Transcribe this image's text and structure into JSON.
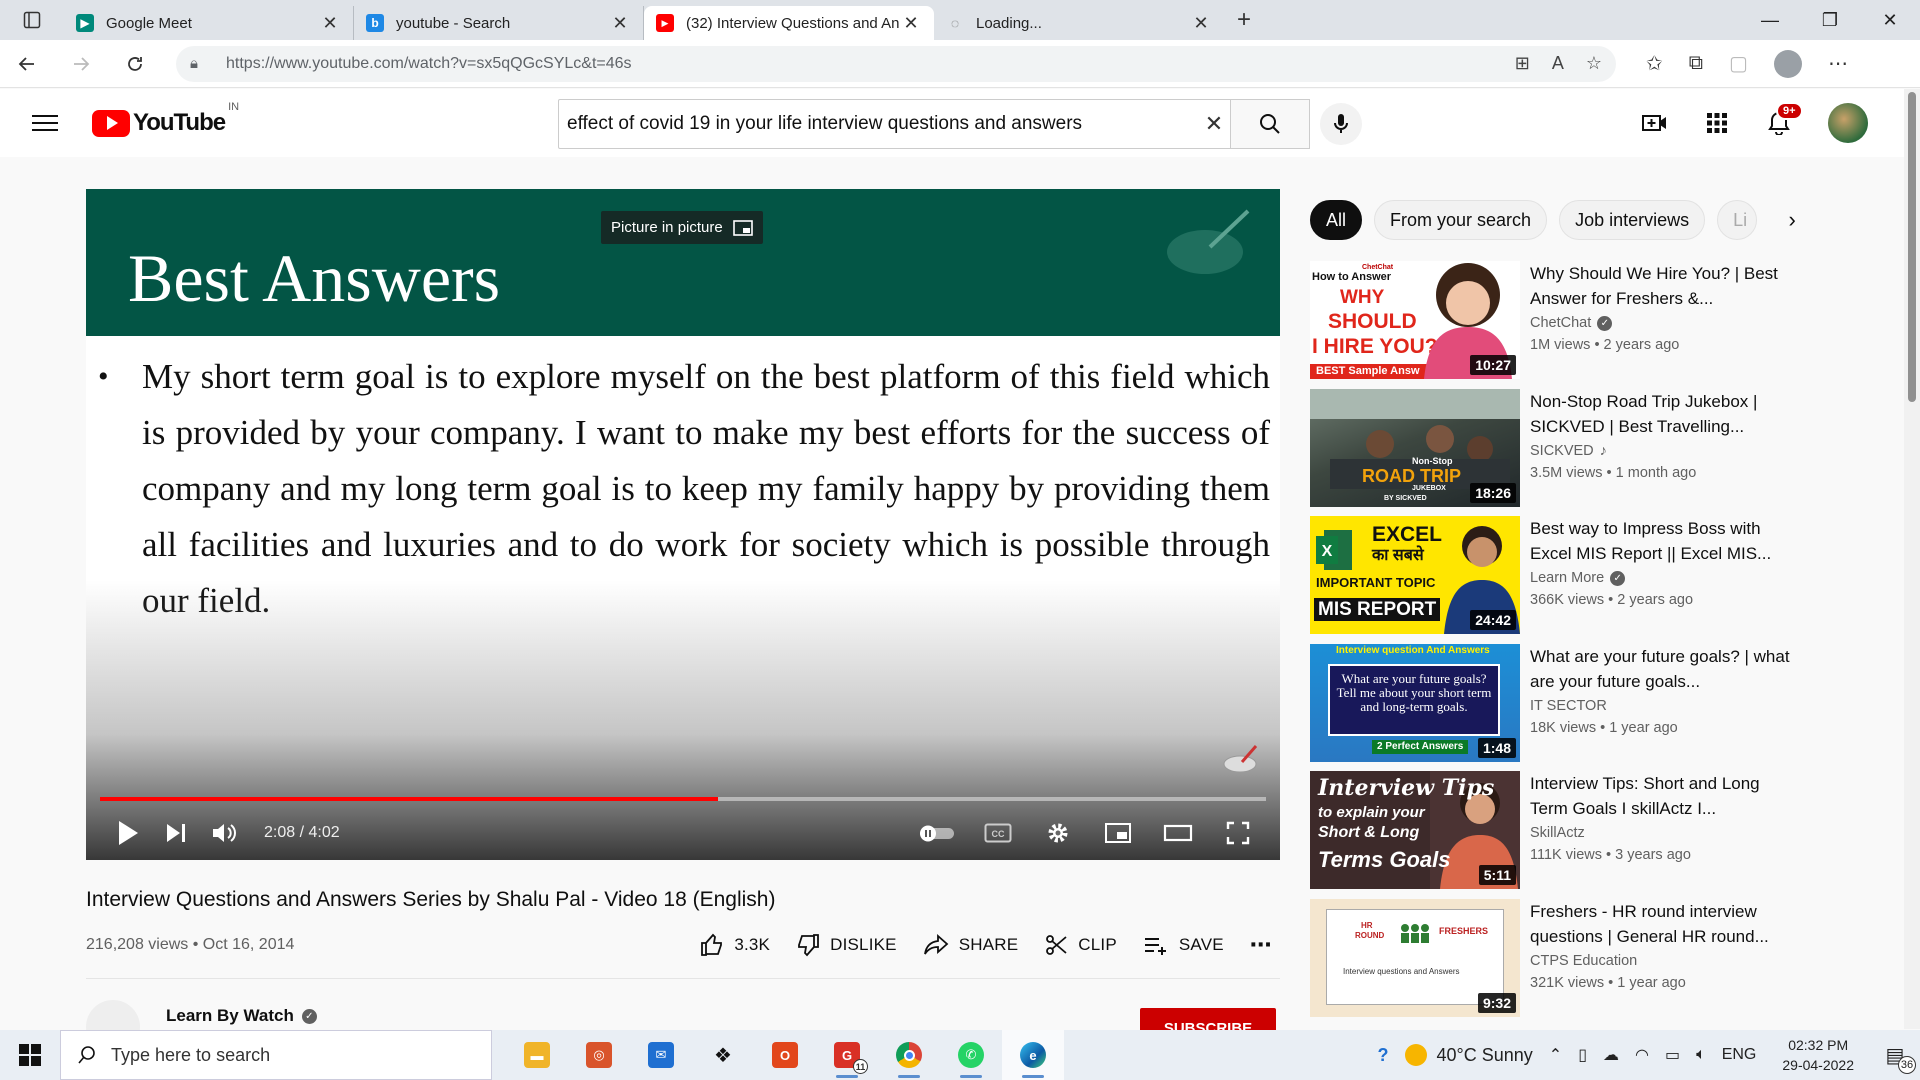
{
  "browser": {
    "tabs": [
      {
        "title": "Google Meet",
        "icon": "google-meet-icon"
      },
      {
        "title": "youtube - Search",
        "icon": "bing-icon"
      },
      {
        "title": "(32) Interview Questions and Ans",
        "icon": "youtube-icon"
      },
      {
        "title": "Loading...",
        "icon": "loading-icon"
      }
    ],
    "url": "https://www.youtube.com/watch?v=sx5qQGcSYLc&t=46s"
  },
  "youtube": {
    "logo_text": "YouTube",
    "country": "IN",
    "search_value": "effect of covid 19 in your life interview questions and answers",
    "notification_count": "9+"
  },
  "player": {
    "slide_title": "Best Answers",
    "slide_text": "My short term goal is to explore myself on the best platform of this field which is provided by your company. I want to make my best efforts for the success of company and my long term goal is to keep my family happy by providing them all facilities and luxuries and to do work for society which is possible through our field.",
    "pip_label": "Picture in picture",
    "time": "2:08 / 4:02",
    "progress": 0.53
  },
  "video": {
    "title": "Interview Questions and Answers Series by Shalu Pal - Video 18 (English)",
    "views_date": "216,208 views • Oct 16, 2014",
    "actions": {
      "likes": "3.3K",
      "dislike": "DISLIKE",
      "share": "SHARE",
      "clip": "CLIP",
      "save": "SAVE"
    },
    "channel": "Learn By Watch",
    "subscribe": "SUBSCRIBE"
  },
  "sidebar": {
    "chips": [
      "All",
      "From your search",
      "Job interviews",
      "Li"
    ],
    "recommendations": [
      {
        "title": "Why Should We Hire You? | Best Answer for Freshers &...",
        "channel": "ChetChat",
        "verified": true,
        "meta": "1M views • 2 years ago",
        "duration": "10:27",
        "thumb_text": [
          "How to Answer",
          "WHY",
          "SHOULD",
          "I HIRE YOU?",
          "BEST Sample Answ",
          "ChetChat"
        ]
      },
      {
        "title": "Non-Stop Road Trip Jukebox | SICKVED | Best Travelling...",
        "channel": "SICKVED",
        "music": true,
        "meta": "3.5M views • 1 month ago",
        "duration": "18:26",
        "thumb_text": [
          "Non-Stop",
          "ROAD TRIP",
          "JUKEBOX",
          "BY SICKVED"
        ]
      },
      {
        "title": "Best way to Impress Boss with Excel MIS Report || Excel MIS...",
        "channel": "Learn More",
        "verified": true,
        "meta": "366K views • 2 years ago",
        "duration": "24:42",
        "thumb_text": [
          "EXCEL",
          "का सबसे",
          "IMPORTANT TOPIC",
          "MIS REPORT"
        ]
      },
      {
        "title": "What are your future goals? | what are your future goals...",
        "channel": "IT SECTOR",
        "meta": "18K views • 1 year ago",
        "duration": "1:48",
        "thumb_text": [
          "Interview question And Answers",
          "What are your future goals? Tell me about your short term and long-term goals.",
          "2 Perfect Answers"
        ]
      },
      {
        "title": "Interview Tips: Short and Long Term Goals I skillActz I...",
        "channel": "SkillActz",
        "meta": "111K views • 3 years ago",
        "duration": "5:11",
        "thumb_text": [
          "Interview Tips",
          "to explain your",
          "Short & Long",
          "Terms Goals"
        ]
      },
      {
        "title": "Freshers - HR round interview questions | General HR round...",
        "channel": "CTPS Education",
        "meta": "321K views • 1 year ago",
        "duration": "9:32",
        "thumb_text": [
          "HR",
          "ROUND",
          "FRESHERS",
          "Interview questions and Answers"
        ]
      }
    ]
  },
  "taskbar": {
    "search_placeholder": "Type here to search",
    "weather": "40°C  Sunny",
    "lang": "ENG",
    "time": "02:32 PM",
    "date": "29-04-2022",
    "notifications": "36",
    "mail_badge": "11"
  }
}
